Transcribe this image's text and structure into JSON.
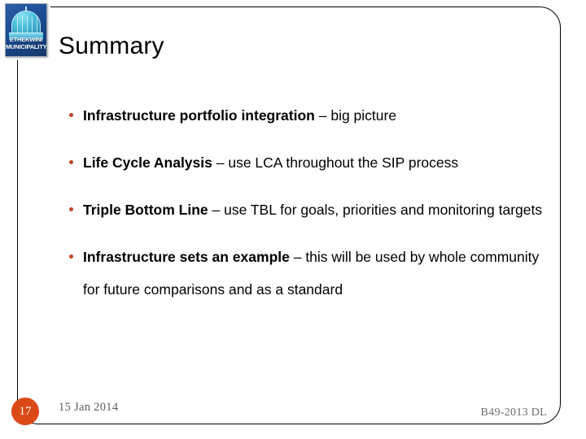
{
  "slide": {
    "title": "Summary",
    "logo": {
      "line1": "ETHEKWINI",
      "line2": "MUNICIPALITY",
      "alt": "eThekwini Municipality crest"
    },
    "bullets": [
      {
        "lead": "Infrastructure portfolio integration",
        "rest": " – big picture"
      },
      {
        "lead": "Life Cycle Analysis",
        "rest": " – use LCA throughout the SIP process"
      },
      {
        "lead": "Triple Bottom Line",
        "rest": " – use TBL for goals, priorities and monitoring targets"
      },
      {
        "lead": "Infrastructure sets an example",
        "rest": " – this will be used by whole community for future comparisons and as a standard"
      }
    ],
    "footer": {
      "slide_number": "17",
      "date": "15 Jan 2014",
      "code": "B49-2013 DL"
    },
    "colors": {
      "bullet": "#C0432A",
      "slide_number_badge": "#DB4916",
      "logo_background": "#1d4f96",
      "text": "#000000"
    }
  }
}
